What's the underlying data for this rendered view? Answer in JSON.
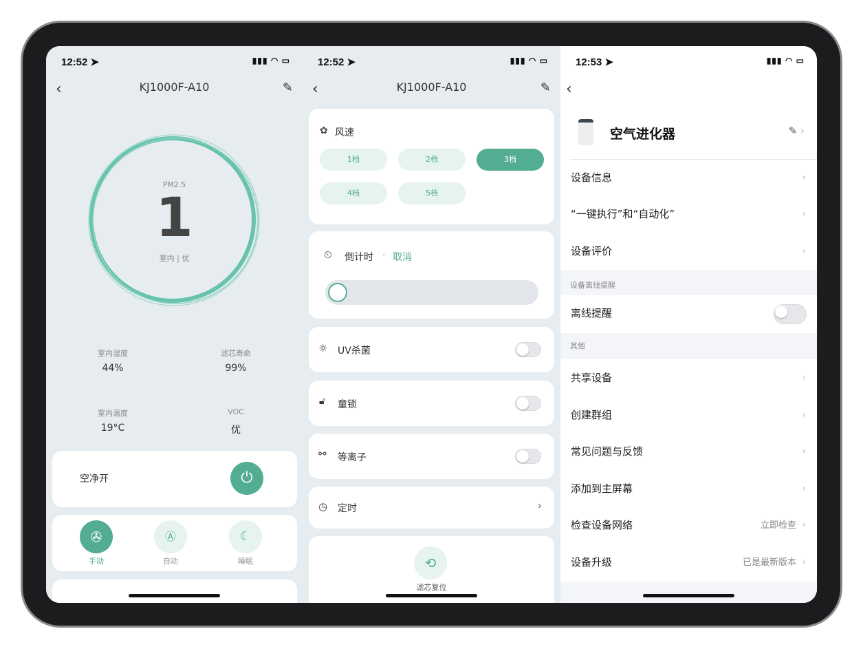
{
  "accent": "#52ad93",
  "screen1": {
    "time": "12:52",
    "title": "KJ1000F-A10",
    "pm_label": "PM2.5",
    "pm_value": "1",
    "pm_status": "室内 | 优",
    "stats": [
      {
        "label": "室内湿度",
        "value": "44%"
      },
      {
        "label": "滤芯寿命",
        "value": "99%"
      },
      {
        "label": "室内温度",
        "value": "19°C"
      },
      {
        "label": "VOC",
        "value": "优"
      }
    ],
    "power_label": "空净开",
    "modes": [
      {
        "label": "手动",
        "icon": "fan-icon",
        "active": true
      },
      {
        "label": "自动",
        "icon": "auto-icon",
        "active": false
      },
      {
        "label": "睡眠",
        "icon": "moon-icon",
        "active": false
      }
    ]
  },
  "screen2": {
    "time": "12:52",
    "title": "KJ1000F-A10",
    "fan_speed_label": "风速",
    "speeds": [
      "1档",
      "2档",
      "3档",
      "4档",
      "5档"
    ],
    "selected_speed": "3档",
    "countdown_label": "倒计时",
    "countdown_sep": "·",
    "countdown_cancel": "取消",
    "countdown_value": 0,
    "uv_label": "UV杀菌",
    "uv_on": false,
    "lock_label": "童锁",
    "lock_on": false,
    "ion_label": "等离子",
    "ion_on": false,
    "timer_label": "定时",
    "filter_reset_label": "滤芯复位"
  },
  "screen3": {
    "time": "12:53",
    "device_name": "空气进化器",
    "rows_top": [
      "设备信息",
      "“一键执行”和“自动化”",
      "设备评价"
    ],
    "offline_section": "设备离线提醒",
    "offline_label": "离线提醒",
    "offline_on": false,
    "other_section": "其他",
    "rows_other": [
      {
        "label": "共享设备",
        "value": ""
      },
      {
        "label": "创建群组",
        "value": ""
      },
      {
        "label": "常见问题与反馈",
        "value": ""
      },
      {
        "label": "添加到主屏幕",
        "value": ""
      },
      {
        "label": "检查设备网络",
        "value": "立即检查"
      },
      {
        "label": "设备升级",
        "value": "已是最新版本"
      }
    ]
  }
}
